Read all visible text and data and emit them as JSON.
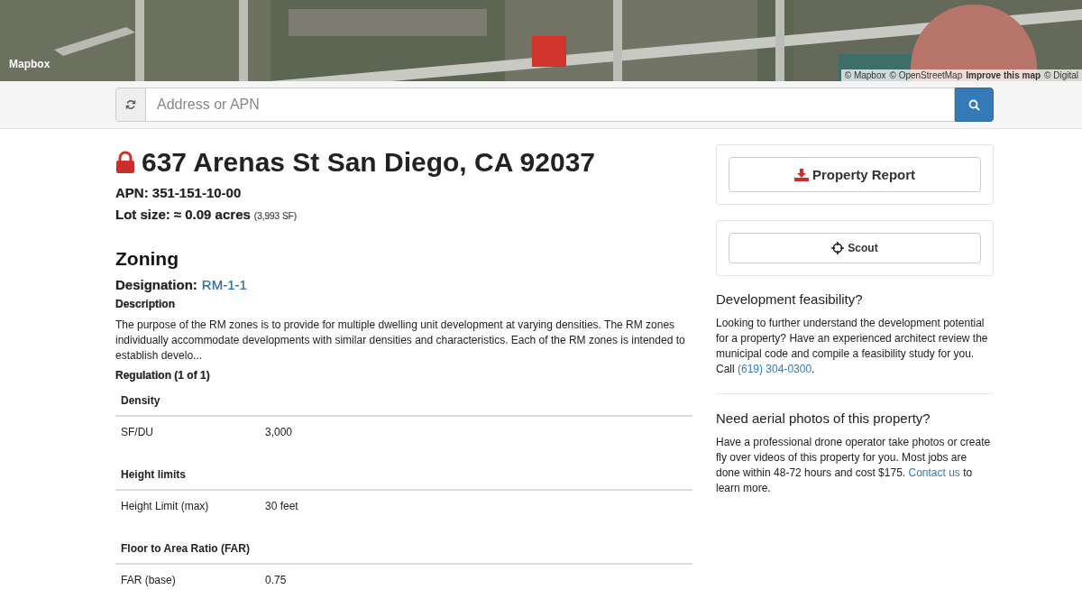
{
  "map": {
    "logo": "Mapbox",
    "attribution": [
      {
        "text": "© Mapbox",
        "kind": "plain"
      },
      {
        "text": "© OpenStreetMap",
        "kind": "plain"
      },
      {
        "text": "Improve this map",
        "kind": "bold"
      },
      {
        "text": "© Digital",
        "kind": "plain"
      }
    ]
  },
  "search": {
    "placeholder": "Address or APN"
  },
  "property": {
    "locked": true,
    "address": "637 Arenas St San Diego, CA 92037",
    "apn": "APN: 351-151-10-00",
    "lot_label": "Lot size:",
    "lot_value": "≈ 0.09 acres",
    "lot_sf": "(3,993 SF)"
  },
  "zoning": {
    "title": "Zoning",
    "designation_label": "Designation:",
    "designation": "RM-1-1",
    "description_label": "Description",
    "description": "The purpose of the RM zones is to provide for multiple dwelling unit development at varying densities. The RM zones individually accommodate developments with similar densities and characteristics. Each of the RM zones is intended to establish develo...",
    "regulation": "Regulation (1 of 1)",
    "sections": [
      {
        "title": "Density",
        "rows": [
          {
            "name": "SF/DU",
            "value": "3,000"
          }
        ]
      },
      {
        "title": "Height limits",
        "rows": [
          {
            "name": "Height Limit (max)",
            "value": "30 feet"
          }
        ]
      },
      {
        "title": "Floor to Area Ratio (FAR)",
        "rows": [
          {
            "name": "FAR (base)",
            "value": "0.75"
          }
        ]
      }
    ]
  },
  "actions": [
    {
      "label": "Property Report",
      "kind": "download"
    },
    {
      "label": "Scout",
      "kind": "crosshair"
    }
  ],
  "info": [
    {
      "title": "Development feasibility?",
      "before": "Looking to further understand the development potential for a property? Have an experienced architect review the municipal code and compile a feasibility study for you. Call ",
      "link": "(619) 304-0300",
      "after": "."
    },
    {
      "title": "Need aerial photos of this property?",
      "before": "Have a professional drone operator take photos or create fly over videos of this property for you. Most jobs are done within 48-72 hours and cost $175. ",
      "link": "Contact us",
      "after": " to learn more."
    }
  ]
}
